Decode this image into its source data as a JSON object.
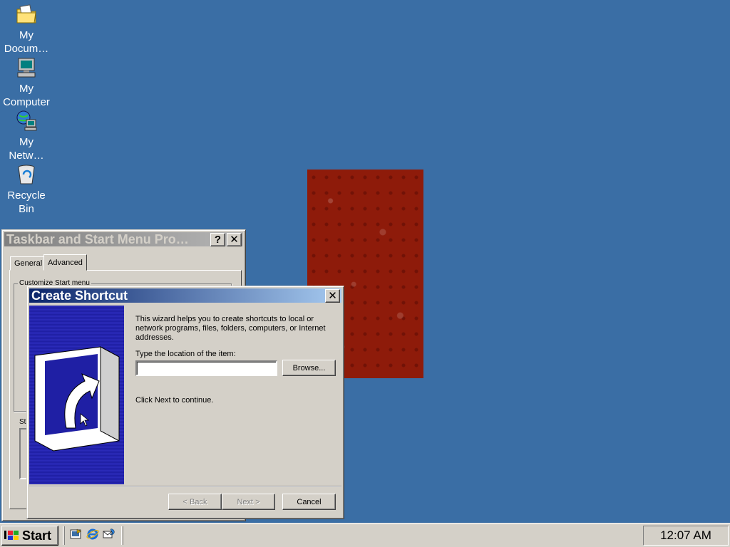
{
  "desktop": {
    "icons": [
      {
        "label": "My\nDocum…",
        "icon": "folder-documents-icon"
      },
      {
        "label": "My\nComputer",
        "icon": "computer-icon"
      },
      {
        "label": "My\nNetw…",
        "icon": "network-icon"
      },
      {
        "label": "Recycle\nBin",
        "icon": "recycle-bin-icon"
      }
    ]
  },
  "taskbar_props": {
    "title": "Taskbar and Start Menu Pro…",
    "help_btn": "?",
    "close_btn": "✕",
    "tabs": [
      "General",
      "Advanced"
    ],
    "active_tab": "Advanced",
    "group_label": "Customize Start menu",
    "start_label": "St"
  },
  "create_shortcut": {
    "title": "Create Shortcut",
    "close_btn": "✕",
    "intro": "This wizard helps you to create shortcuts to local or network programs, files, folders, computers, or Internet addresses.",
    "location_label": "Type the location of the item:",
    "location_value": "",
    "browse_label": "Browse...",
    "continue_text": "Click Next to continue.",
    "back_label": "< Back",
    "next_label": "Next >",
    "cancel_label": "Cancel"
  },
  "taskbar": {
    "start_label": "Start",
    "quick_launch": [
      "show-desktop-icon",
      "internet-explorer-icon",
      "outlook-express-icon"
    ],
    "clock": "12:07 AM"
  }
}
